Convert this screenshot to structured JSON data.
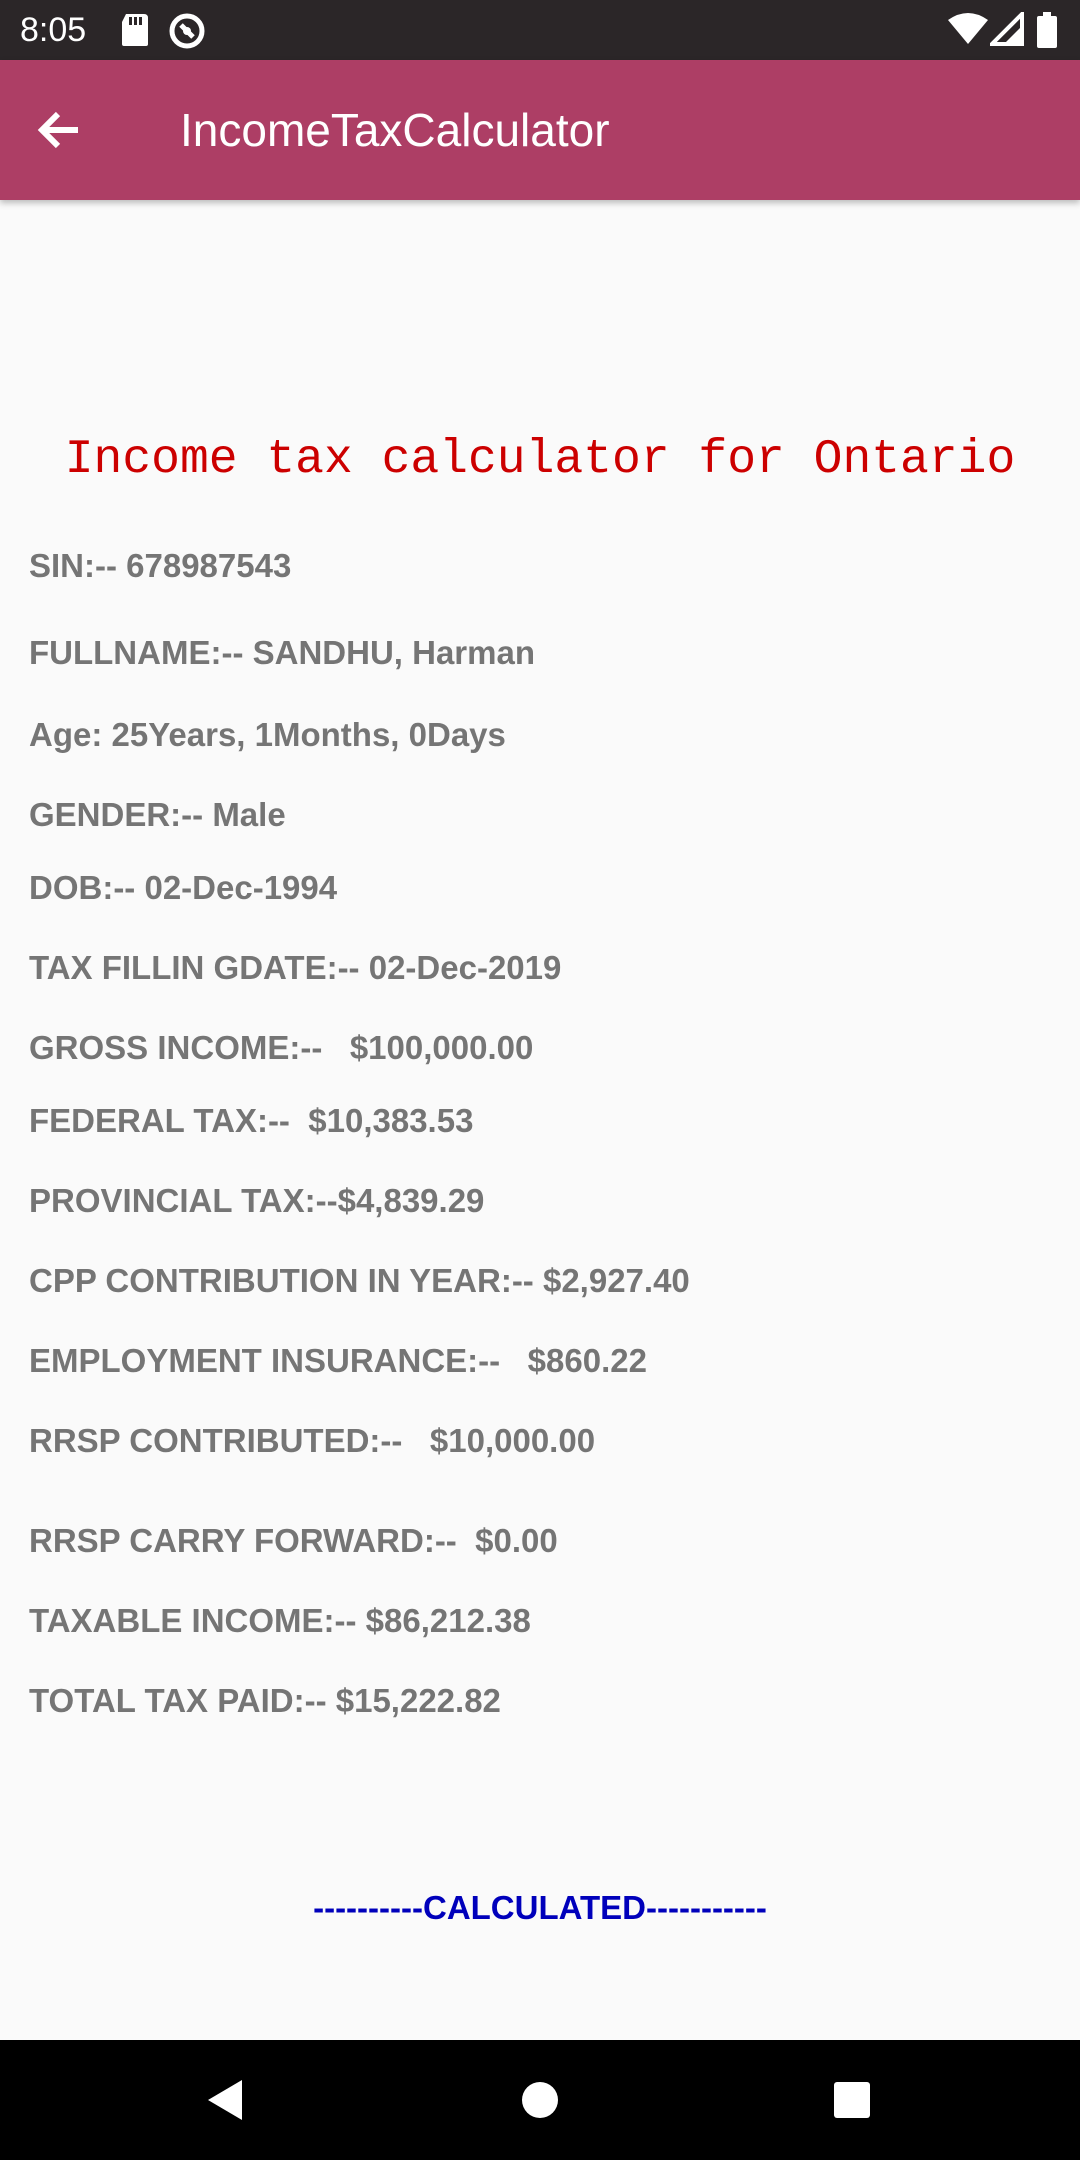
{
  "status_bar": {
    "time": "8:05",
    "icons": [
      "sd-card-icon",
      "sync-icon",
      "wifi-icon",
      "signal-icon",
      "battery-icon"
    ]
  },
  "app_bar": {
    "title": "IncomeTaxCalculator",
    "back_icon": "arrow-back-icon",
    "color": "#ad3e65"
  },
  "content": {
    "heading": "Income tax calculator for Ontario",
    "heading_color": "#cc0000",
    "lines": {
      "sin": "SIN:-- 678987543",
      "fullname": "FULLNAME:-- SANDHU, Harman",
      "age": "Age: 25Years, 1Months, 0Days",
      "gender": "GENDER:-- Male",
      "dob": "DOB:-- 02-Dec-1994",
      "tax_filling_date": "TAX FILLIN GDATE:-- 02-Dec-2019",
      "gross_income": "GROSS INCOME:--   $100,000.00",
      "federal_tax": "FEDERAL TAX:--  $10,383.53",
      "provincial_tax": "PROVINCIAL TAX:--$4,839.29",
      "cpp_contribution": "CPP CONTRIBUTION IN YEAR:-- $2,927.40",
      "employment_insurance": "EMPLOYMENT INSURANCE:--   $860.22",
      "rrsp_contributed": "RRSP CONTRIBUTED:--   $10,000.00",
      "rrsp_carry_forward": "RRSP CARRY FORWARD:--  $0.00",
      "taxable_income": "TAXABLE INCOME:-- $86,212.38",
      "total_tax_paid": "TOTAL TAX PAID:-- $15,222.82"
    },
    "footer": "----------CALCULATED-----------",
    "footer_color": "#0000bb"
  },
  "nav_bar": {
    "buttons": [
      "back-triangle-icon",
      "home-circle-icon",
      "recents-square-icon"
    ]
  }
}
